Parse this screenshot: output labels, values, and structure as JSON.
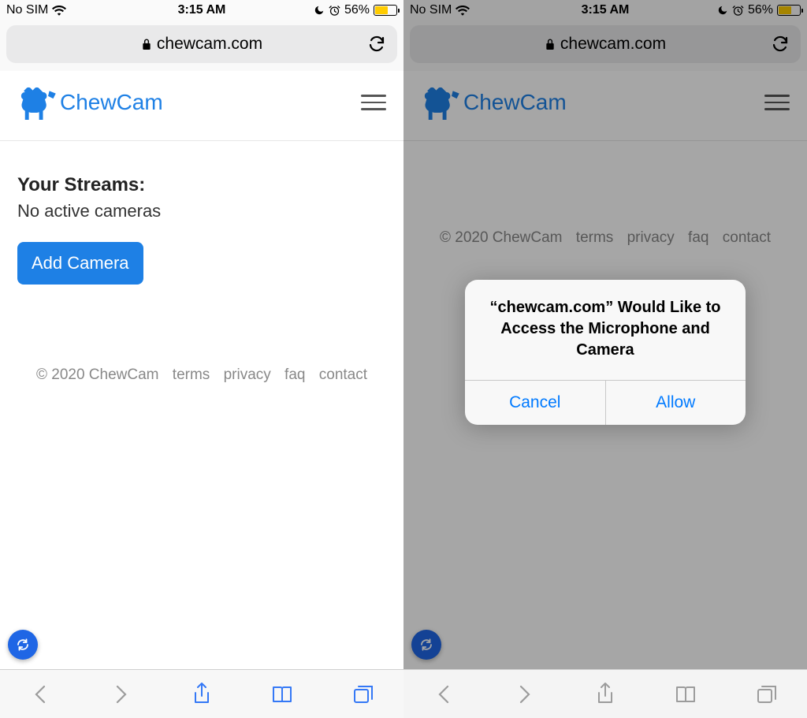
{
  "status": {
    "carrier": "No SIM",
    "time": "3:15 AM",
    "battery_pct": "56%"
  },
  "url": {
    "domain": "chewcam.com"
  },
  "logo": {
    "text": "ChewCam"
  },
  "streams": {
    "title": "Your Streams:",
    "status": "No active cameras",
    "add_label": "Add Camera"
  },
  "footer": {
    "copyright": "© 2020 ChewCam",
    "links": [
      "terms",
      "privacy",
      "faq",
      "contact"
    ]
  },
  "dialog": {
    "text": "“chewcam.com” Would Like to Access the Microphone and Camera",
    "cancel": "Cancel",
    "allow": "Allow"
  }
}
